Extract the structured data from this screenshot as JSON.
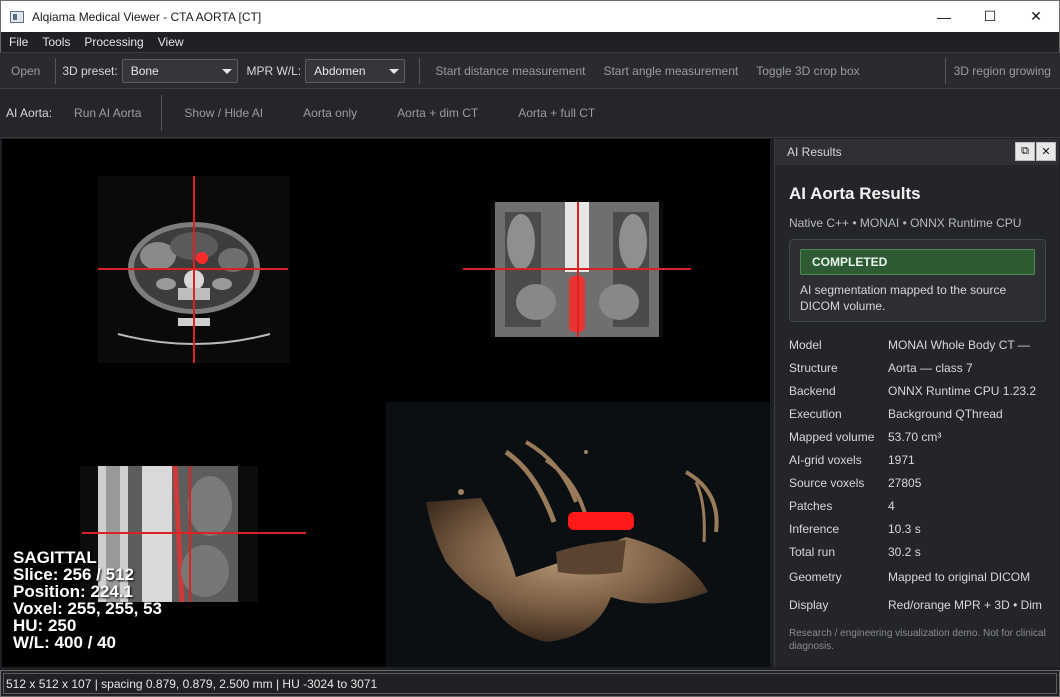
{
  "window": {
    "title": "Alqiama Medical Viewer - CTA AORTA [CT]",
    "minimize": "—",
    "maximize": "☐",
    "close": "✕"
  },
  "menu": [
    "File",
    "Tools",
    "Processing",
    "View"
  ],
  "toolbar1": {
    "open": "Open",
    "preset_label": "3D preset:",
    "preset_value": "Bone",
    "mpr_label": "MPR W/L:",
    "mpr_value": "Abdomen",
    "distance": "Start distance measurement",
    "angle": "Start angle measurement",
    "crop": "Toggle 3D crop box",
    "region": "3D region growing"
  },
  "toolbar2": {
    "label": "AI Aorta:",
    "run": "Run AI Aorta",
    "show_hide": "Show / Hide AI",
    "aorta_only": "Aorta only",
    "dim_ct": "Aorta + dim CT",
    "full_ct": "Aorta + full CT"
  },
  "overlay": {
    "plane": "SAGITTAL",
    "slice": "Slice: 256 / 512",
    "position": "Position: 224.1",
    "voxel": "Voxel: 255, 255, 53",
    "hu": "HU: 250",
    "wl": "W/L: 400 / 40"
  },
  "ai_panel": {
    "header": "AI Results",
    "title": "AI Aorta Results",
    "subtitle": "Native C++ • MONAI • ONNX Runtime CPU",
    "status": "COMPLETED",
    "status_message": "AI segmentation mapped to the source DICOM volume.",
    "rows": [
      {
        "k": "Model",
        "v": "MONAI Whole Body CT —"
      },
      {
        "k": "Structure",
        "v": "Aorta — class 7"
      },
      {
        "k": "Backend",
        "v": "ONNX Runtime CPU 1.23.2"
      },
      {
        "k": "Execution",
        "v": "Background QThread"
      },
      {
        "k": "Mapped volume",
        "v": "53.70 cm³"
      },
      {
        "k": "AI-grid voxels",
        "v": "1971"
      },
      {
        "k": "Source voxels",
        "v": "27805"
      },
      {
        "k": "Patches",
        "v": "4"
      },
      {
        "k": "Inference",
        "v": "10.3 s"
      },
      {
        "k": "Total run",
        "v": "30.2 s"
      },
      {
        "k": "Geometry",
        "v": "Mapped to original DICOM"
      },
      {
        "k": "Display",
        "v": "Red/orange MPR + 3D • Dim"
      }
    ],
    "disclaimer": "Research / engineering visualization demo. Not for clinical diagnosis."
  },
  "statusbar": "512 x 512 x 107 | spacing 0.879, 0.879, 2.500 mm | HU -3024 to 3071",
  "colors": {
    "crosshair": "#e02020",
    "segmentation": "#ff1a1a",
    "status_green": "#2e5b33"
  }
}
